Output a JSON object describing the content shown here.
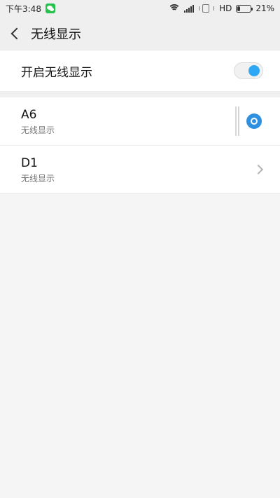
{
  "status_bar": {
    "time": "下午3:48",
    "network": "HD",
    "battery": "21%",
    "battery_level": 21
  },
  "header": {
    "title": "无线显示"
  },
  "toggle": {
    "label": "开启无线显示",
    "enabled": true
  },
  "devices": [
    {
      "name": "A6",
      "subtitle": "无线显示"
    },
    {
      "name": "D1",
      "subtitle": "无线显示"
    }
  ],
  "colors": {
    "accent": "#2ea7f5"
  }
}
